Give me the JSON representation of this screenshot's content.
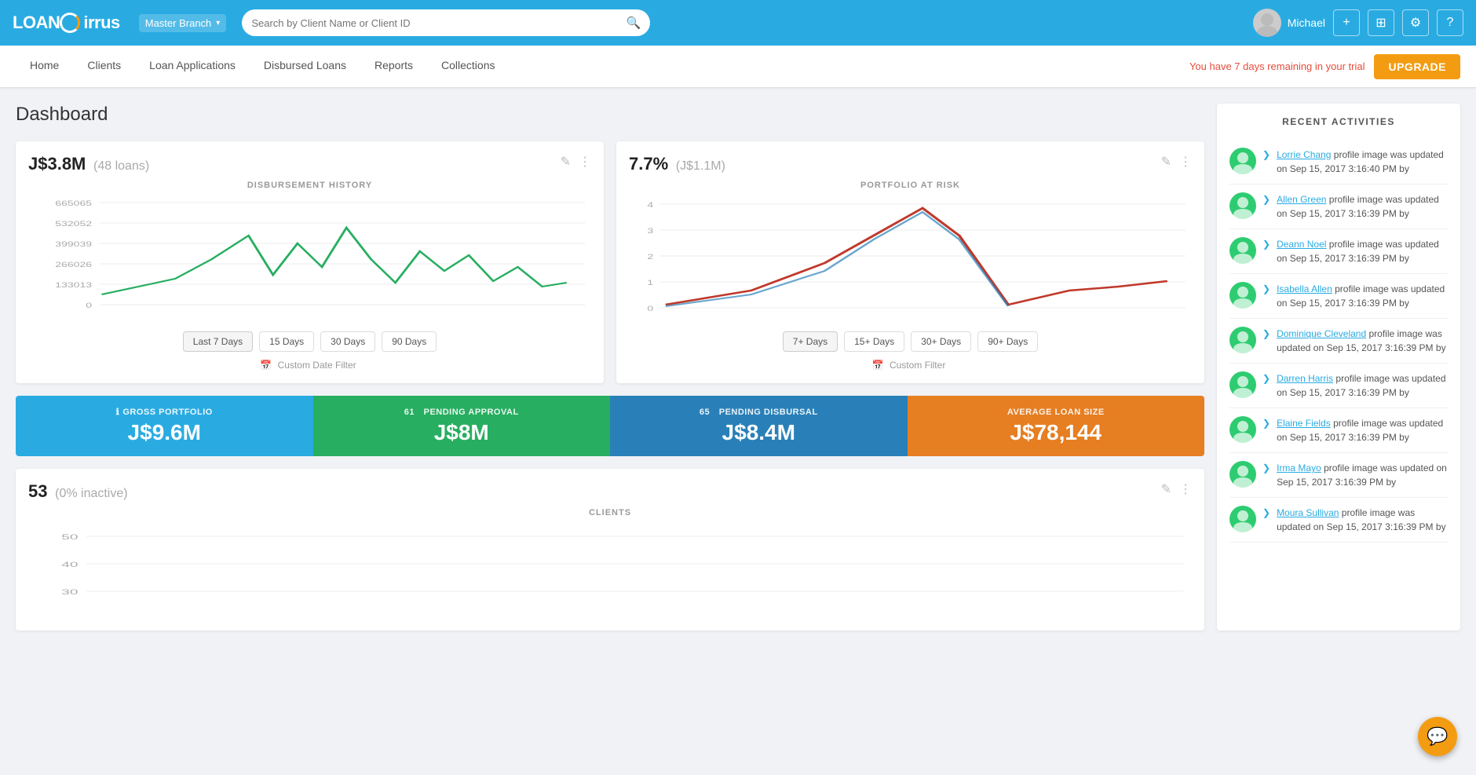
{
  "app": {
    "name": "LoanCirrus",
    "branch": "Master Branch"
  },
  "search": {
    "placeholder": "Search by Client Name or Client ID"
  },
  "user": {
    "name": "Michael"
  },
  "nav": {
    "items": [
      "Home",
      "Clients",
      "Loan Applications",
      "Disbursed Loans",
      "Reports",
      "Collections"
    ]
  },
  "trial": {
    "message": "You have 7 days remaining in your trial",
    "upgrade_label": "UPGRADE"
  },
  "page": {
    "title": "Dashboard"
  },
  "disbursement": {
    "value": "J$3.8M",
    "sub": "(48 loans)",
    "chart_title": "DISBURSEMENT HISTORY",
    "y_labels": [
      "665065",
      "532052",
      "399039",
      "266026",
      "133013",
      "0"
    ],
    "filters": [
      "Last 7\nDays",
      "15 Days",
      "30 Days",
      "90 Days"
    ],
    "custom_filter": "Custom Date Filter"
  },
  "portfolio": {
    "value": "7.7%",
    "sub": "(J$1.1M)",
    "chart_title": "PORTFOLIO AT RISK",
    "y_labels": [
      "4",
      "3",
      "2",
      "1",
      "0"
    ],
    "filters": [
      "7+ Days",
      "15+ Days",
      "30+ Days",
      "90+ Days"
    ],
    "custom_filter": "Custom Filter"
  },
  "stats": [
    {
      "label": "GROSS PORTFOLIO",
      "value": "J$9.6M",
      "color": "cyan",
      "icon": "ℹ"
    },
    {
      "label": "PENDING APPROVAL",
      "count": "61",
      "value": "J$8M",
      "color": "green"
    },
    {
      "label": "PENDING DISBURSAL",
      "count": "65",
      "value": "J$8.4M",
      "color": "blue"
    },
    {
      "label": "AVERAGE LOAN SIZE",
      "value": "J$78,144",
      "color": "orange"
    }
  ],
  "clients": {
    "value": "53",
    "sub": "(0% inactive)",
    "chart_title": "CLIENTS",
    "y_labels": [
      "50",
      "40",
      "30"
    ]
  },
  "recent_activities": {
    "title": "RECENT ACTIVITIES",
    "items": [
      {
        "name": "Lorrie Chang",
        "text": " profile image was updated on Sep 15, 2017 3:16:40 PM by"
      },
      {
        "name": "Allen Green",
        "text": " profile image was updated on Sep 15, 2017 3:16:39 PM by"
      },
      {
        "name": "Deann Noel",
        "text": " profile image was updated on Sep 15, 2017 3:16:39 PM by"
      },
      {
        "name": "Isabella Allen",
        "text": " profile image was updated on Sep 15, 2017 3:16:39 PM by"
      },
      {
        "name": "Dominique Cleveland",
        "text": " profile image was updated on Sep 15, 2017 3:16:39 PM by"
      },
      {
        "name": "Darren Harris",
        "text": " profile image was updated on Sep 15, 2017 3:16:39 PM by"
      },
      {
        "name": "Elaine Fields",
        "text": " profile image was updated on Sep 15, 2017 3:16:39 PM by"
      },
      {
        "name": "Irma Mayo",
        "text": " profile image was updated on Sep 15, 2017 3:16:39 PM by"
      },
      {
        "name": "Moura Sullivan",
        "text": " profile image was updated on Sep 15, 2017 3:16:39 PM by"
      }
    ]
  },
  "icons": {
    "search": "🔍",
    "plus": "+",
    "calculator": "▦",
    "gear": "⚙",
    "question": "?",
    "pencil": "✎",
    "info": "⋮",
    "calendar": "📅",
    "chevron_right": "❯",
    "chat": "💬",
    "info_circle": "ℹ"
  }
}
